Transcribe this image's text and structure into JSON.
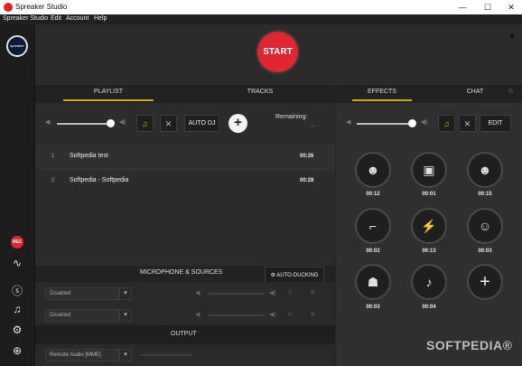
{
  "window": {
    "title": "Spreaker Studio",
    "controls": {
      "minimize": "—",
      "maximize": "☐",
      "close": "✕"
    }
  },
  "menu": [
    "Spreaker Studio",
    "Edit",
    "Account",
    "Help"
  ],
  "sidebar": {
    "avatar_label": "spreaker",
    "rec_label": "REC",
    "icons": [
      "rec-icon",
      "waveform-icon",
      "skype-icon",
      "music-icon",
      "settings-icon",
      "lifebuoy-icon"
    ]
  },
  "start_button": "START",
  "left_tabs": {
    "playlist": "PLAYLIST",
    "tracks": "TRACKS"
  },
  "right_tabs": {
    "effects": "EFFECTS",
    "chat": "CHAT"
  },
  "playlist_controls": {
    "autodj": "AUTO DJ",
    "add": "+",
    "remaining_label": "Remaining:",
    "remaining_value": "..."
  },
  "playlist": [
    {
      "num": "1",
      "title": "Softpedia test",
      "time": "00:26"
    },
    {
      "num": "2",
      "title": "Softpedia - Softpedia",
      "time": "00:28"
    }
  ],
  "effects_controls": {
    "edit": "EDIT"
  },
  "effects": [
    {
      "icon": "applause-icon",
      "glyph": "☻",
      "time": "00:12"
    },
    {
      "icon": "camera-icon",
      "glyph": "▣",
      "time": "00:01"
    },
    {
      "icon": "crowd-icon",
      "glyph": "☻",
      "time": "00:15"
    },
    {
      "icon": "gun-icon",
      "glyph": "⌐",
      "time": "00:02"
    },
    {
      "icon": "lightning-icon",
      "glyph": "⚡",
      "time": "00:13"
    },
    {
      "icon": "laugh-icon",
      "glyph": "☺",
      "time": "00:03"
    },
    {
      "icon": "spy-icon",
      "glyph": "☗",
      "time": "00:03"
    },
    {
      "icon": "bell-icon",
      "glyph": "♪",
      "time": "00:04"
    },
    {
      "icon": "add-effect-icon",
      "glyph": "+",
      "time": ""
    }
  ],
  "microphone": {
    "header": "MICROPHONE & SOURCES",
    "autoducking": "AUTO-DUCKING",
    "sources": [
      {
        "value": "Disabled"
      },
      {
        "value": "Disabled"
      }
    ]
  },
  "output": {
    "header": "OUTPUT",
    "device": "Remote Audio [MME]"
  },
  "watermark": "SOFTPEDIA®",
  "colors": {
    "accent": "#d4aa17",
    "start": "#e0262e",
    "background": "#262626"
  }
}
